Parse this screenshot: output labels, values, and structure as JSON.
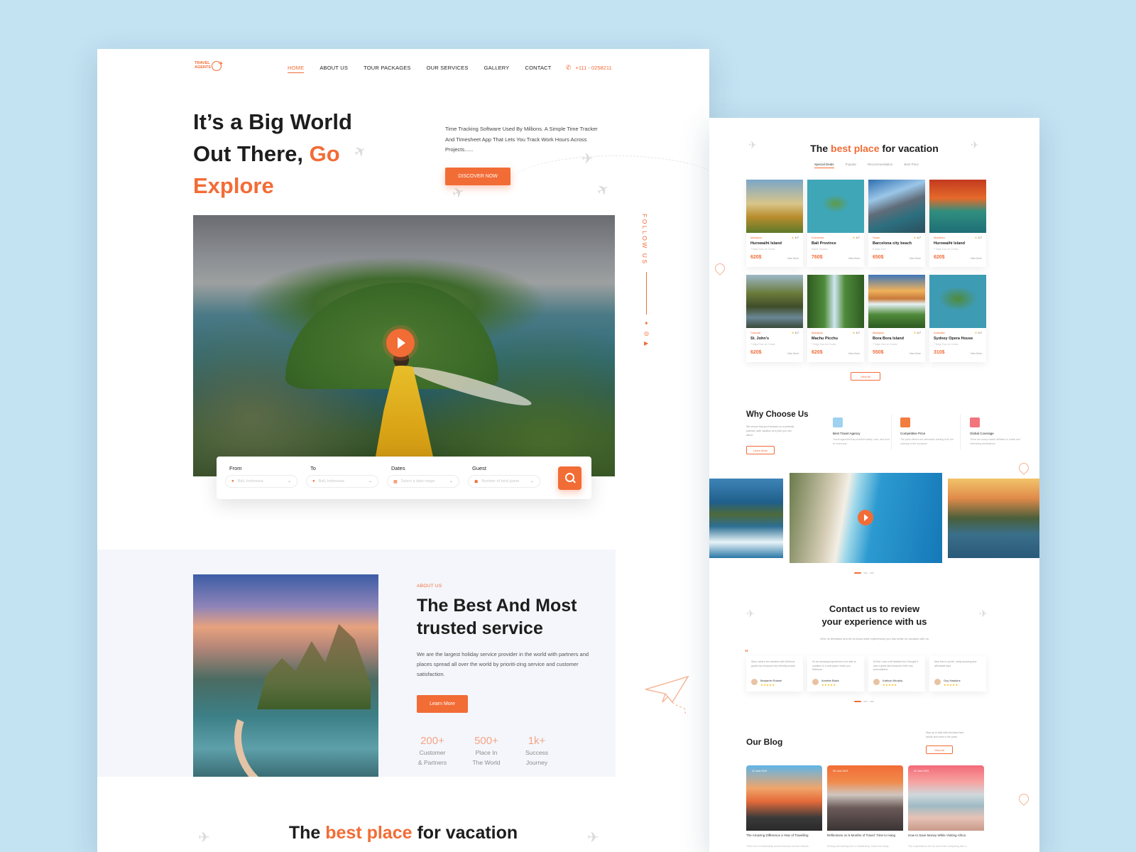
{
  "nav": {
    "logo_text": "TRAVEL AGENTS",
    "items": [
      "HOME",
      "ABOUT US",
      "TOUR PACKAGES",
      "OUR SERVICES",
      "GALLERY",
      "CONTACT"
    ],
    "phone": "+111 - 0258211"
  },
  "hero": {
    "title_line1": "It’s a Big World",
    "title_line2a": "Out There,",
    "title_line2b": "Go",
    "title_line3": "Explore",
    "description": "Time Tracking Software Used By Millions. A Simple Time Tracker And Timesheet App That Lets You Track Work Hours Across Projects......",
    "cta": "DISCOVER NOW",
    "follow": "FOLLOW US"
  },
  "search": {
    "fields": [
      {
        "label": "From",
        "placeholder": "Bali, Indonesia"
      },
      {
        "label": "To",
        "placeholder": "Bali, Indonesia"
      },
      {
        "label": "Dates",
        "placeholder": "Select a date range"
      },
      {
        "label": "Guest",
        "placeholder": "Number of total guest"
      }
    ]
  },
  "about": {
    "tag": "ABOUT US",
    "title": "The Best And Most trusted service",
    "description": "We are the largest holiday service provider in the world with partners and places spread all over the world by prioriti-zing service and customer satisfaction.",
    "cta": "Learn More",
    "stats": [
      {
        "num": "200+",
        "label1": "Customer",
        "label2": "& Partners"
      },
      {
        "num": "500+",
        "label1": "Place In",
        "label2": "The World"
      },
      {
        "num": "1k+",
        "label1": "Success",
        "label2": "Journey"
      }
    ]
  },
  "bottom_title": {
    "pre": "The",
    "accent": "best place",
    "post": "for vacation"
  },
  "right": {
    "title": {
      "pre": "The",
      "accent": "best place",
      "post": "for vacation"
    },
    "tabs": [
      "Special Deals",
      "Popular",
      "Recommendation",
      "Best Price"
    ],
    "cards": [
      {
        "loc": "Malaysia",
        "rate": "4.7",
        "name": "Hurowaihi Island",
        "sub": "7 Days Tour on Cruise",
        "price": "620$",
        "more": "View More"
      },
      {
        "loc": "Indonesia",
        "rate": "4.7",
        "name": "Bali Province",
        "sub": "Island Tourism",
        "price": "760$",
        "more": "View More"
      },
      {
        "loc": "Spain",
        "rate": "4.7",
        "name": "Barcelona city beach",
        "sub": "5 Days Tour",
        "price": "650$",
        "more": "View More"
      },
      {
        "loc": "Maldives",
        "rate": "4.7",
        "name": "Hurowaihi Island",
        "sub": "7 Days Tour on Cruise",
        "price": "620$",
        "more": "View More"
      },
      {
        "loc": "Canada",
        "rate": "4.7",
        "name": "St. John's",
        "sub": "7 Days Tour on Cruise",
        "price": "620$",
        "more": "View More"
      },
      {
        "loc": "Malaysia",
        "rate": "4.7",
        "name": "Machu Picchu",
        "sub": "7 Days Tour on Cruise",
        "price": "620$",
        "more": "View More"
      },
      {
        "loc": "Malaysia",
        "rate": "4.7",
        "name": "Bora Bora Island",
        "sub": "7 Days Tour on Cruise",
        "price": "550$",
        "more": "View More"
      },
      {
        "loc": "Australia",
        "rate": "4.7",
        "name": "Sydney Opera House",
        "sub": "7 Days Tour on Cruise",
        "price": "310$",
        "more": "View More"
      }
    ],
    "view_all": "View All",
    "why": {
      "title": "Why Choose Us",
      "desc": "We ensure that you'll embark on a perfectly planned, safe vacation at a price you can afford.",
      "cta": "Learn More",
      "items": [
        {
          "title": "Best Travel Agency",
          "desc": "Travel agencies that prioritize safety, care, and trust for every trip."
        },
        {
          "title": "Competitive Price",
          "desc": "The price offered are affordable starting from the ordinary to the exclusive."
        },
        {
          "title": "Global Coverage",
          "desc": "There are many trusted affiliates in hotels and interesting destinations."
        }
      ]
    },
    "contact": {
      "title_line1": "Contact us to review",
      "title_line2": "your experience with us",
      "desc": "Give us feedback and let us know what experiences you had while on vacation with us"
    },
    "reviews": [
      {
        "text": "Wow, what a fun vacation with Delirious guided by everyone very friendly people.",
        "name": "Benjamin Russel",
        "stars": "★★★★★"
      },
      {
        "text": "It's an amazing experience to be able to vacation to a new place, thank you Delirious.",
        "name": "Annette Black",
        "stars": "★★★★★"
      },
      {
        "text": "At first I was a bit hesitant but I thought it was a great idea because it felt very personalized.",
        "name": "Kathryn Murphy",
        "stars": "★★★★★"
      },
      {
        "text": "Now this is my life, really amazing and affordable trips.",
        "name": "Guy Hawkins",
        "stars": "★★★★★"
      }
    ],
    "blog": {
      "title": "Our Blog",
      "desc": "Stay up to date with the latest tech trends and news in the parts.",
      "cta": "View All",
      "posts": [
        {
          "date": "10 June 2023",
          "title": "The Amazing Difference a Year of Travelling",
          "excerpt": "There isn't a relationship around that can survive without..."
        },
        {
          "date": "08 June 2023",
          "title": "Reflections on 5 Months of Travel: Time to Hang",
          "excerpt": "Ending and starting from a relationship, travel can really..."
        },
        {
          "date": "02 June 2023",
          "title": "How to Save Money While Visiting Africa",
          "excerpt": "The expectations are far more than comparing with a..."
        }
      ]
    }
  }
}
